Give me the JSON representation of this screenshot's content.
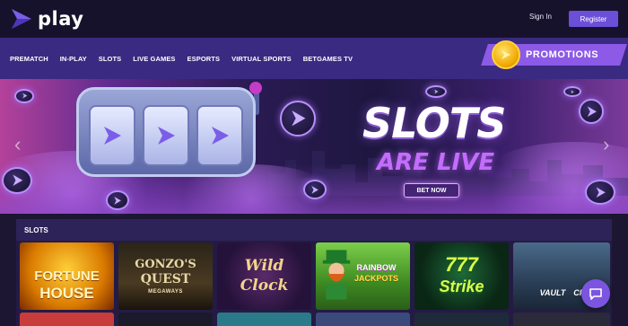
{
  "app": {
    "logo_text": "play"
  },
  "header": {
    "sign_in": "Sign In",
    "register": "Register"
  },
  "nav": {
    "items": [
      "PREMATCH",
      "IN-PLAY",
      "SLOTS",
      "LIVE GAMES",
      "ESPORTS",
      "VIRTUAL SPORTS",
      "BETGAMES TV"
    ],
    "promotions": "PROMOTIONS"
  },
  "hero": {
    "title": "SLOTS",
    "subtitle": "ARE LIVE",
    "cta": "BET NOW"
  },
  "games": {
    "title": "SLOTS",
    "tiles": [
      {
        "line1": "FORTUNE",
        "line2": "HOUSE"
      },
      {
        "line1": "GONZO'S",
        "line2": "QUEST",
        "line3": "MEGAWAYS"
      },
      {
        "line1": "Wild",
        "line2": "Clock"
      },
      {
        "line1": "RAINBOW",
        "line2": "JACKPOTS"
      },
      {
        "line1": "777",
        "line2": "Strike"
      },
      {
        "line1": "VAULT",
        "line2": "CRA"
      }
    ]
  },
  "colors": {
    "accent": "#6b4fd8",
    "nav": "#3a2a82",
    "promo": "#8c5ae6",
    "topbar": "#17122b"
  }
}
